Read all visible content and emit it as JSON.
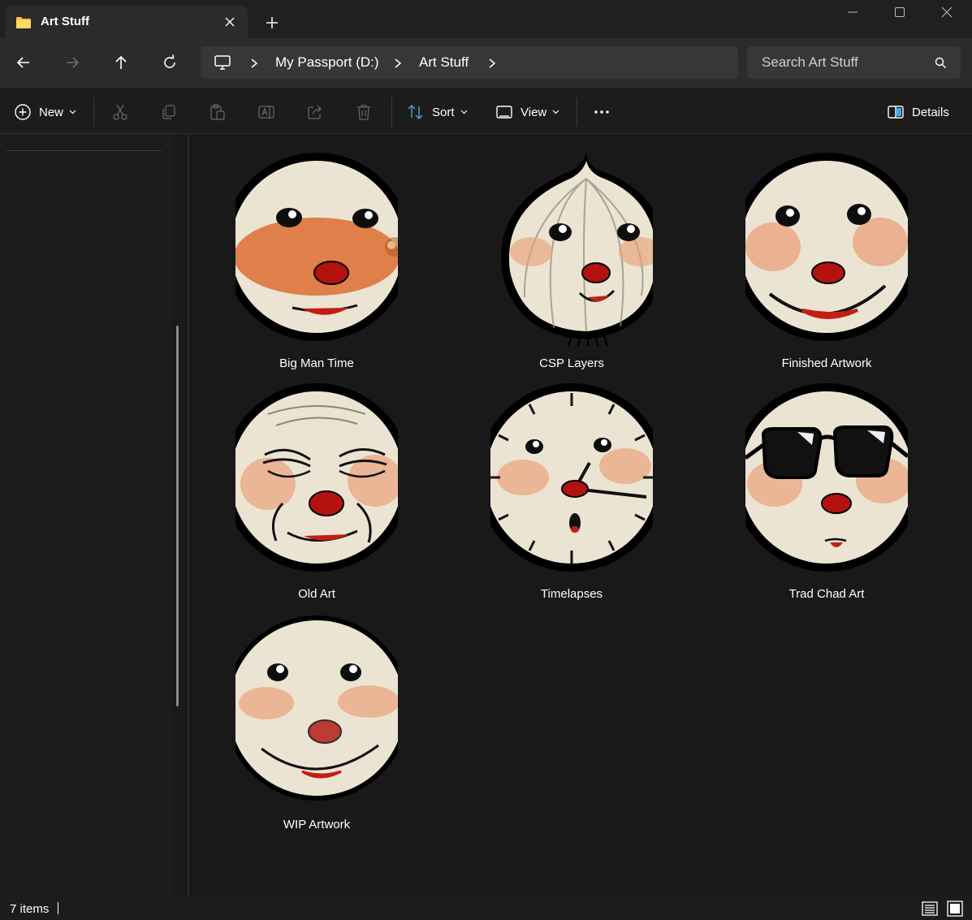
{
  "tab": {
    "title": "Art Stuff",
    "icon": "folder-icon"
  },
  "breadcrumb": {
    "drive": "My Passport (D:)",
    "folder": "Art Stuff"
  },
  "search": {
    "placeholder": "Search Art Stuff"
  },
  "toolbar": {
    "new_label": "New",
    "sort_label": "Sort",
    "view_label": "View",
    "details_label": "Details"
  },
  "items": [
    {
      "name": "Big Man Time",
      "thumb": "big-man-face"
    },
    {
      "name": "CSP Layers",
      "thumb": "onion-face"
    },
    {
      "name": "Finished Artwork",
      "thumb": "smile-face"
    },
    {
      "name": "Old Art",
      "thumb": "old-face"
    },
    {
      "name": "Timelapses",
      "thumb": "clock-face"
    },
    {
      "name": "Trad Chad Art",
      "thumb": "sunglasses-face"
    },
    {
      "name": "WIP Artwork",
      "thumb": "sketch-face"
    }
  ],
  "status": {
    "item_count": "7 items"
  },
  "colors": {
    "face": "#ebe4d2",
    "nose": "#b3120f",
    "blush": "#e9a27a",
    "accent": "#4aa3df",
    "folder": "#f6c343"
  }
}
